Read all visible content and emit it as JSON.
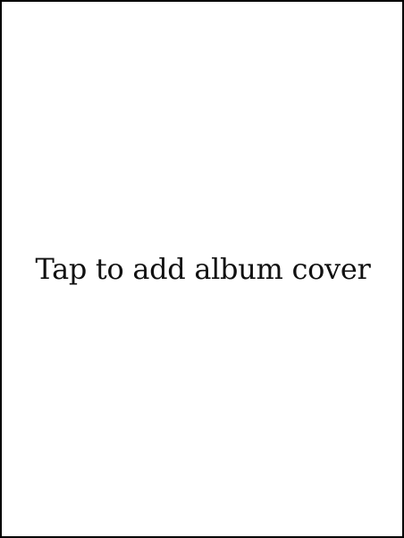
{
  "album_cover": {
    "prompt": "Tap to add album cover"
  },
  "colors": {
    "background": "#ffffff",
    "border": "#000000",
    "text": "#111111"
  }
}
